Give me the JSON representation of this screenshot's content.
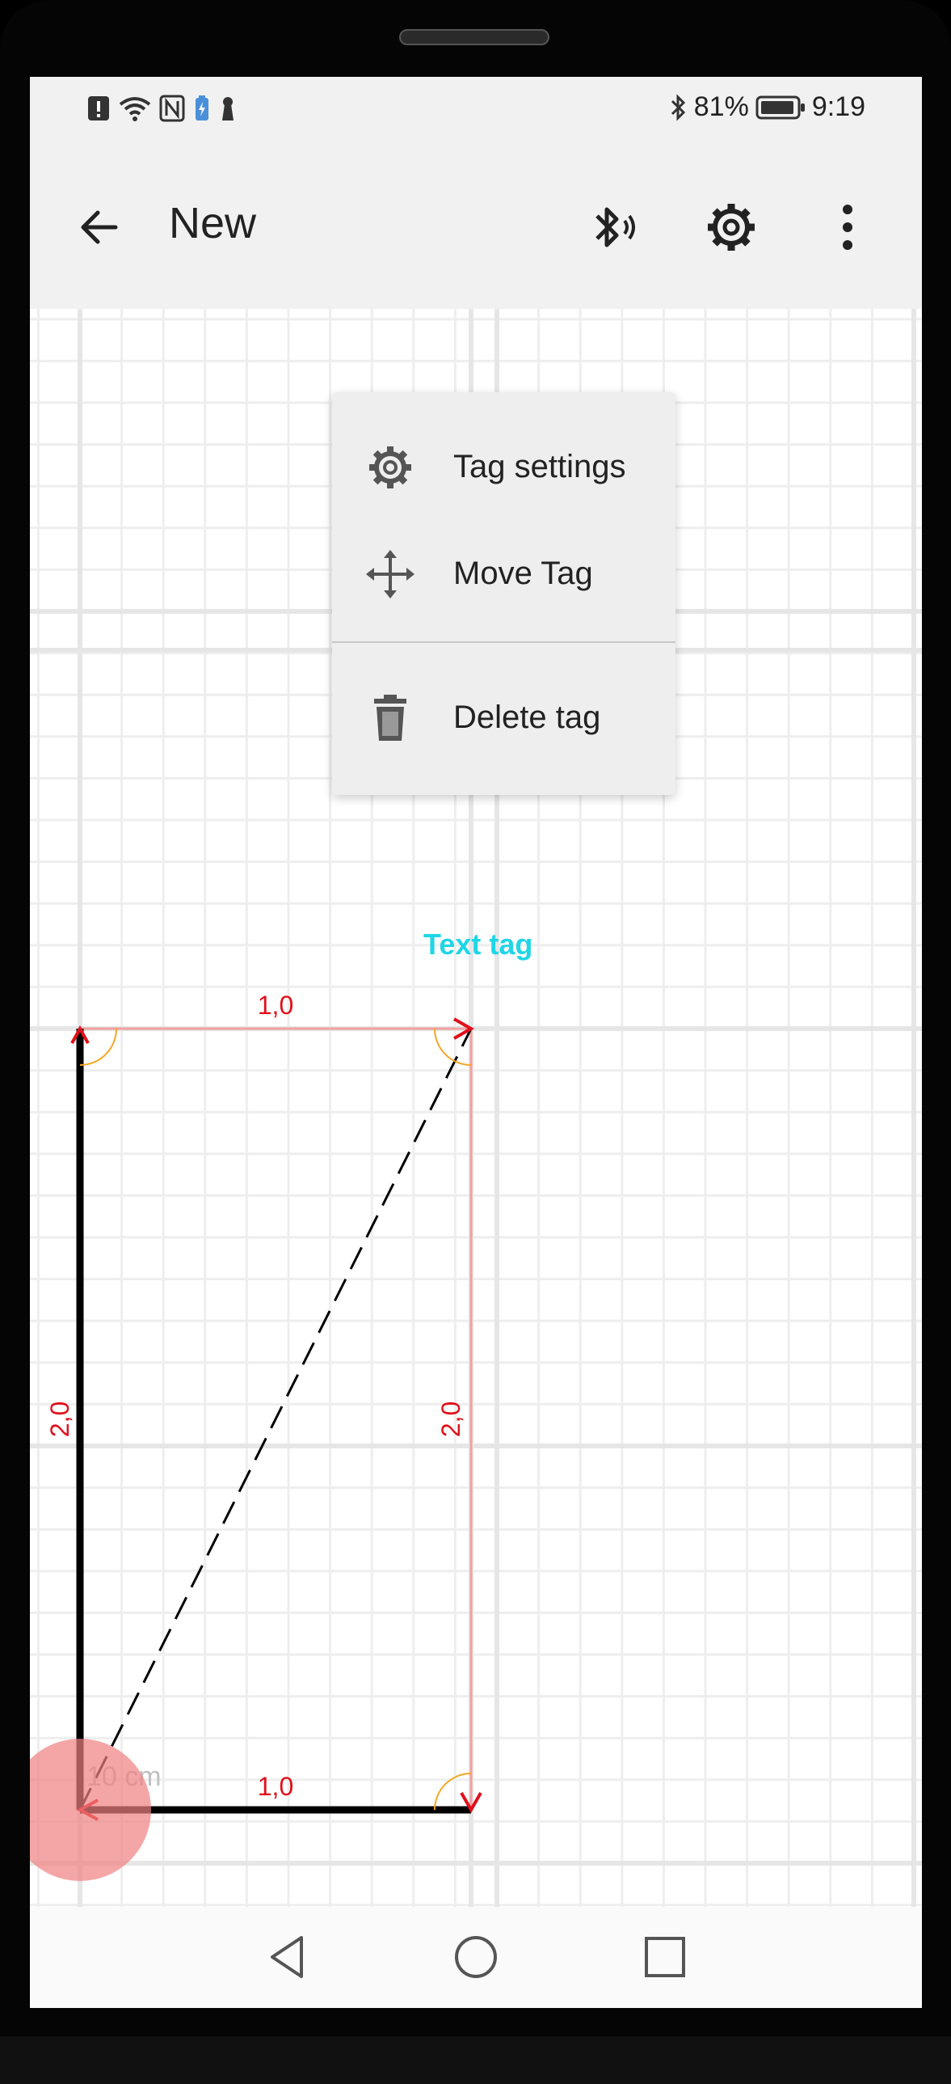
{
  "status_bar": {
    "battery_percent": "81%",
    "time": "9:19"
  },
  "app_bar": {
    "title": "New"
  },
  "context_menu": {
    "items": [
      {
        "label": "Tag settings",
        "icon": "gear-icon"
      },
      {
        "label": "Move Tag",
        "icon": "move-icon"
      },
      {
        "label": "Delete tag",
        "icon": "trash-icon"
      }
    ]
  },
  "drawing": {
    "text_tag": "Text tag",
    "top_label": "1,0",
    "bottom_label": "1,0",
    "left_label": "2,0",
    "right_label": "2,0",
    "scale_label": "10 cm",
    "colors": {
      "dimension": "#e0101a",
      "text_tag": "#1fd6e6",
      "line": "#000000",
      "light_line": "#f1a0a0",
      "angle_arc": "#f5a623",
      "selection": "#f08080"
    }
  },
  "nav_bar": {
    "back_icon": "triangle-back-icon",
    "home_icon": "circle-home-icon",
    "recents_icon": "square-recents-icon"
  }
}
